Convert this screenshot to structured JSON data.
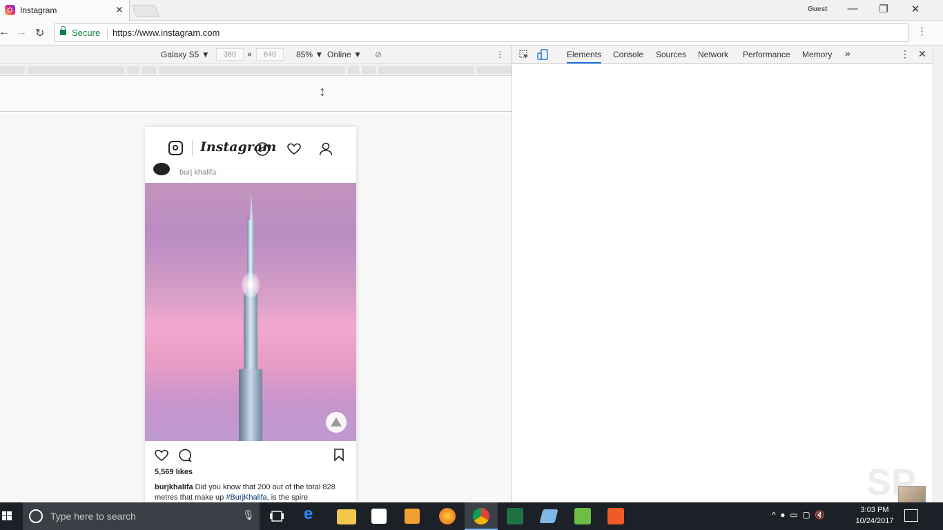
{
  "tab": {
    "title": "Instagram",
    "close": "✕"
  },
  "window": {
    "profile": "Guest",
    "minimize": "—",
    "restore": "❐",
    "close": "✕"
  },
  "address": {
    "secure_label": "Secure",
    "url": "https://www.instagram.com"
  },
  "device_toolbar": {
    "device": "Galaxy S5 ▼",
    "width": "360",
    "times": "×",
    "height": "640",
    "zoom": "85% ▼",
    "network": "Online ▼"
  },
  "devtools": {
    "tabs": [
      "Elements",
      "Console",
      "Sources",
      "Network",
      "Performance",
      "Memory"
    ],
    "more": "»"
  },
  "instagram": {
    "wordmark": "Instagram",
    "post_user_partial": "burj khalifa",
    "likes": "5,569 likes",
    "caption_user": "burjkhalifa",
    "caption_text_1": " Did you know that 200 out of the total 828 metres that make up ",
    "caption_tag": "#BurjKhalifa",
    "caption_text_2": ", is the spire"
  },
  "watermark": "SP",
  "taskbar": {
    "search_placeholder": "Type here to search",
    "time": "3:03 PM",
    "date": "10/24/2017"
  },
  "colors": {
    "secure_green": "#0b8043",
    "devtools_active": "#1a73e8",
    "taskbar": "#1c2027"
  }
}
